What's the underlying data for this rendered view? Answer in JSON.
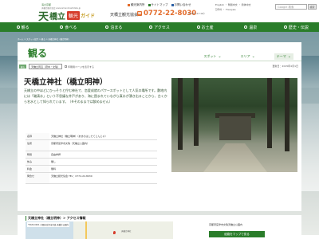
{
  "header": {
    "logo_tagline": "海の京都",
    "logo_url": "天橋立観光協会 www.amanohashidate.jp",
    "logo_main_1": "天",
    "logo_main_2": "橋立",
    "logo_badge": "観光",
    "logo_guide": "ガイド",
    "association": "天橋立観光協会",
    "phone": "0772-22-8030",
    "hours": "（9:00～17:00）",
    "top_links": [
      {
        "label": "観光案内所",
        "icon": "square-icon"
      },
      {
        "label": "サイトマップ",
        "icon": "square-icon"
      },
      {
        "label": "お問い合わせ",
        "icon": "square-icon"
      }
    ],
    "lang_links_1": "English ・ 繁體中文 ・ 简体中文",
    "lang_links_2": "한국어 ・ Français",
    "search_placeholder": "Google 検索",
    "search_button": "検索"
  },
  "nav": [
    {
      "label": "観る",
      "icon": "eye-icon"
    },
    {
      "label": "食べる",
      "icon": "fork-icon"
    },
    {
      "label": "泊まる",
      "icon": "bed-icon"
    },
    {
      "label": "アクセス",
      "icon": "bus-icon"
    },
    {
      "label": "お土産",
      "icon": "gift-icon"
    },
    {
      "label": "温泉",
      "icon": "onsen-icon"
    },
    {
      "label": "歴史・伝説",
      "icon": "scroll-icon"
    }
  ],
  "breadcrumb": "ホーム > スポット紹介 > 観る > 天橋立神社（橋立明神）",
  "section": {
    "title": "観る",
    "tabs": [
      {
        "label": "スポット"
      },
      {
        "label": "エリア"
      },
      {
        "label": "テーマ"
      }
    ]
  },
  "tags": {
    "category": "観る",
    "area": "天橋立周辺（府中・文珠）",
    "share": "印刷用ページを表示する",
    "update": "更新日：2015年4月1日"
  },
  "spot": {
    "title": "天橋立神社（橋立明神）",
    "description": "天橋立の中ほどにひっそりと佇む神社で、恋愛成就のパワースポットとして人気の場所です。敷地内には「磯清水」という不思議な井戸があり、海に囲まれていながら真水が湧き出ることから、古くから名水として知られています。（※そのままでは飲めません）"
  },
  "info": [
    {
      "key": "名称",
      "value": "天橋立神社（橋立明神）（あまのはしだてじんじゃ）"
    },
    {
      "key": "住所",
      "value": "京都府宮津市文珠（天橋立公園内）"
    },
    {
      "key": "時間",
      "value": "自由参拝"
    },
    {
      "key": "休み",
      "value": "無し"
    },
    {
      "key": "料金",
      "value": "無料"
    },
    {
      "key": "問合せ",
      "value": "天橋立観光協会  TEL：0772-22-8030"
    }
  ],
  "access": {
    "title": "天橋立神社（橋立明神）> アクセス情報",
    "map_address": "〒626-0001 京都府宮津市文珠 天橋立公園内",
    "map_label": "天橋立神社",
    "route_address": "京都府宮津市文珠天橋立公園内",
    "route_button": "経路をマップで見る"
  },
  "colors": {
    "brand_green": "#2a7d2a",
    "accent_orange": "#e36b2a",
    "accent_red": "#d63b2a"
  }
}
